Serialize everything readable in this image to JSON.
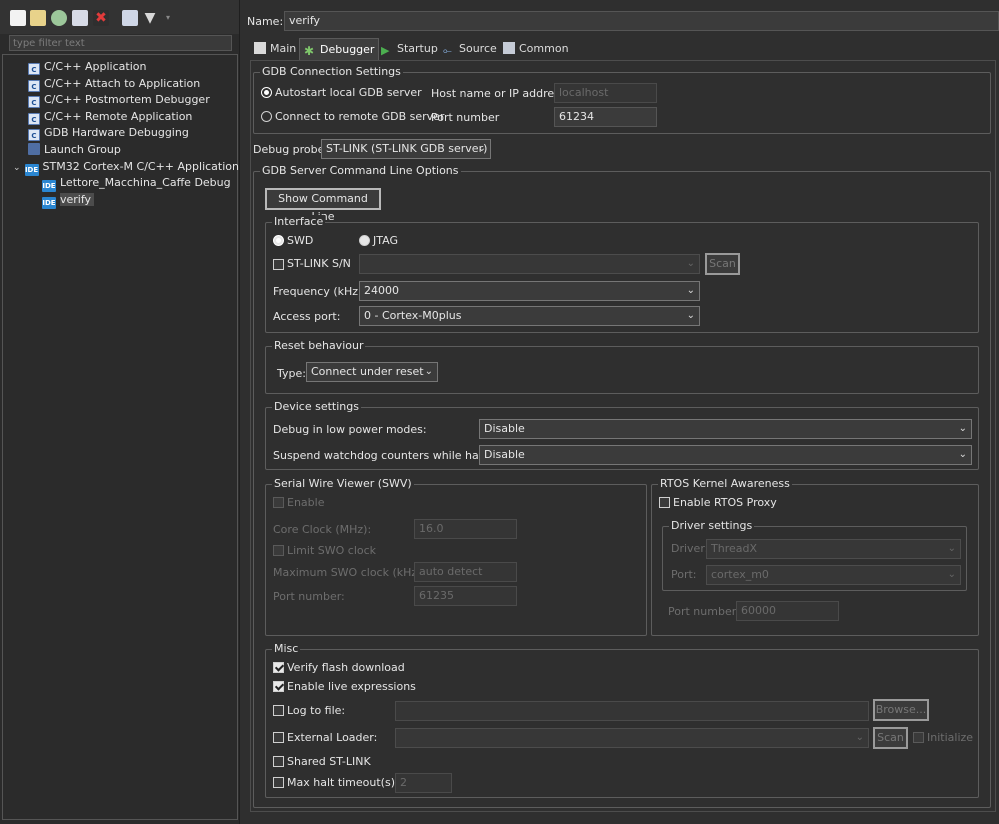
{
  "left": {
    "filter_placeholder": "type filter text",
    "tree": [
      {
        "label": "C/C++ Application",
        "icon": "c-icon"
      },
      {
        "label": "C/C++ Attach to Application",
        "icon": "c-icon"
      },
      {
        "label": "C/C++ Postmortem Debugger",
        "icon": "c-icon"
      },
      {
        "label": "C/C++ Remote Application",
        "icon": "c-icon"
      },
      {
        "label": "GDB Hardware Debugging",
        "icon": "c-icon"
      },
      {
        "label": "Launch Group",
        "icon": "launch-group-icon"
      },
      {
        "label": "STM32 Cortex-M C/C++ Application",
        "icon": "ide-icon",
        "expanded": true
      },
      {
        "label": "Lettore_Macchina_Caffe Debug",
        "icon": "ide-icon"
      },
      {
        "label": "verify",
        "icon": "ide-icon",
        "selected": true
      }
    ]
  },
  "name": {
    "label": "Name:",
    "value": "verify"
  },
  "tabs": [
    {
      "label": "Main",
      "icon": "main-tab-icon"
    },
    {
      "label": "Debugger",
      "icon": "debugger-tab-icon",
      "active": true
    },
    {
      "label": "Startup",
      "icon": "startup-tab-icon"
    },
    {
      "label": "Source",
      "icon": "source-tab-icon"
    },
    {
      "label": "Common",
      "icon": "common-tab-icon"
    }
  ],
  "gdb_conn": {
    "title": "GDB Connection Settings",
    "autostart": "Autostart local GDB server",
    "remote": "Connect to remote GDB server",
    "host_label": "Host name or IP address",
    "host_value": "localhost",
    "port_label": "Port number",
    "port_value": "61234"
  },
  "probe": {
    "label": "Debug probe",
    "value": "ST-LINK (ST-LINK GDB server)"
  },
  "server": {
    "title": "GDB Server Command Line Options",
    "show_cmd": "Show Command Line"
  },
  "interface": {
    "title": "Interface",
    "swd": "SWD",
    "jtag": "JTAG",
    "stlink_sn": "ST-LINK S/N",
    "scan": "Scan",
    "freq_label": "Frequency (kHz):",
    "freq_value": "24000",
    "port_label": "Access port:",
    "port_value": "0 - Cortex-M0plus"
  },
  "reset": {
    "title": "Reset behaviour",
    "type_label": "Type:",
    "type_value": "Connect under reset"
  },
  "device": {
    "title": "Device settings",
    "low_power_label": "Debug in low power modes:",
    "low_power_value": "Disable",
    "watchdog_label": "Suspend watchdog counters while halted:",
    "watchdog_value": "Disable"
  },
  "swv": {
    "title": "Serial Wire Viewer (SWV)",
    "enable": "Enable",
    "core_clock_label": "Core Clock (MHz):",
    "core_clock_value": "16.0",
    "limit_swo": "Limit SWO clock",
    "max_swo_label": "Maximum SWO clock (kHz):",
    "max_swo_value": "auto detect",
    "port_label": "Port number:",
    "port_value": "61235"
  },
  "rtos": {
    "title": "RTOS Kernel Awareness",
    "enable_proxy": "Enable RTOS Proxy",
    "driver_settings": "Driver settings",
    "driver_label": "Driver:",
    "driver_value": "ThreadX",
    "port_label": "Port:",
    "port_value": "cortex_m0",
    "port_number_label": "Port number:",
    "port_number_value": "60000"
  },
  "misc": {
    "title": "Misc",
    "verify_flash": "Verify flash download",
    "live_expr": "Enable live expressions",
    "log_to_file": "Log to file:",
    "browse": "Browse...",
    "ext_loader": "External Loader:",
    "scan": "Scan",
    "initialize": "Initialize",
    "shared_stlink": "Shared ST-LINK",
    "max_halt": "Max halt timeout(s):",
    "max_halt_value": "2"
  }
}
